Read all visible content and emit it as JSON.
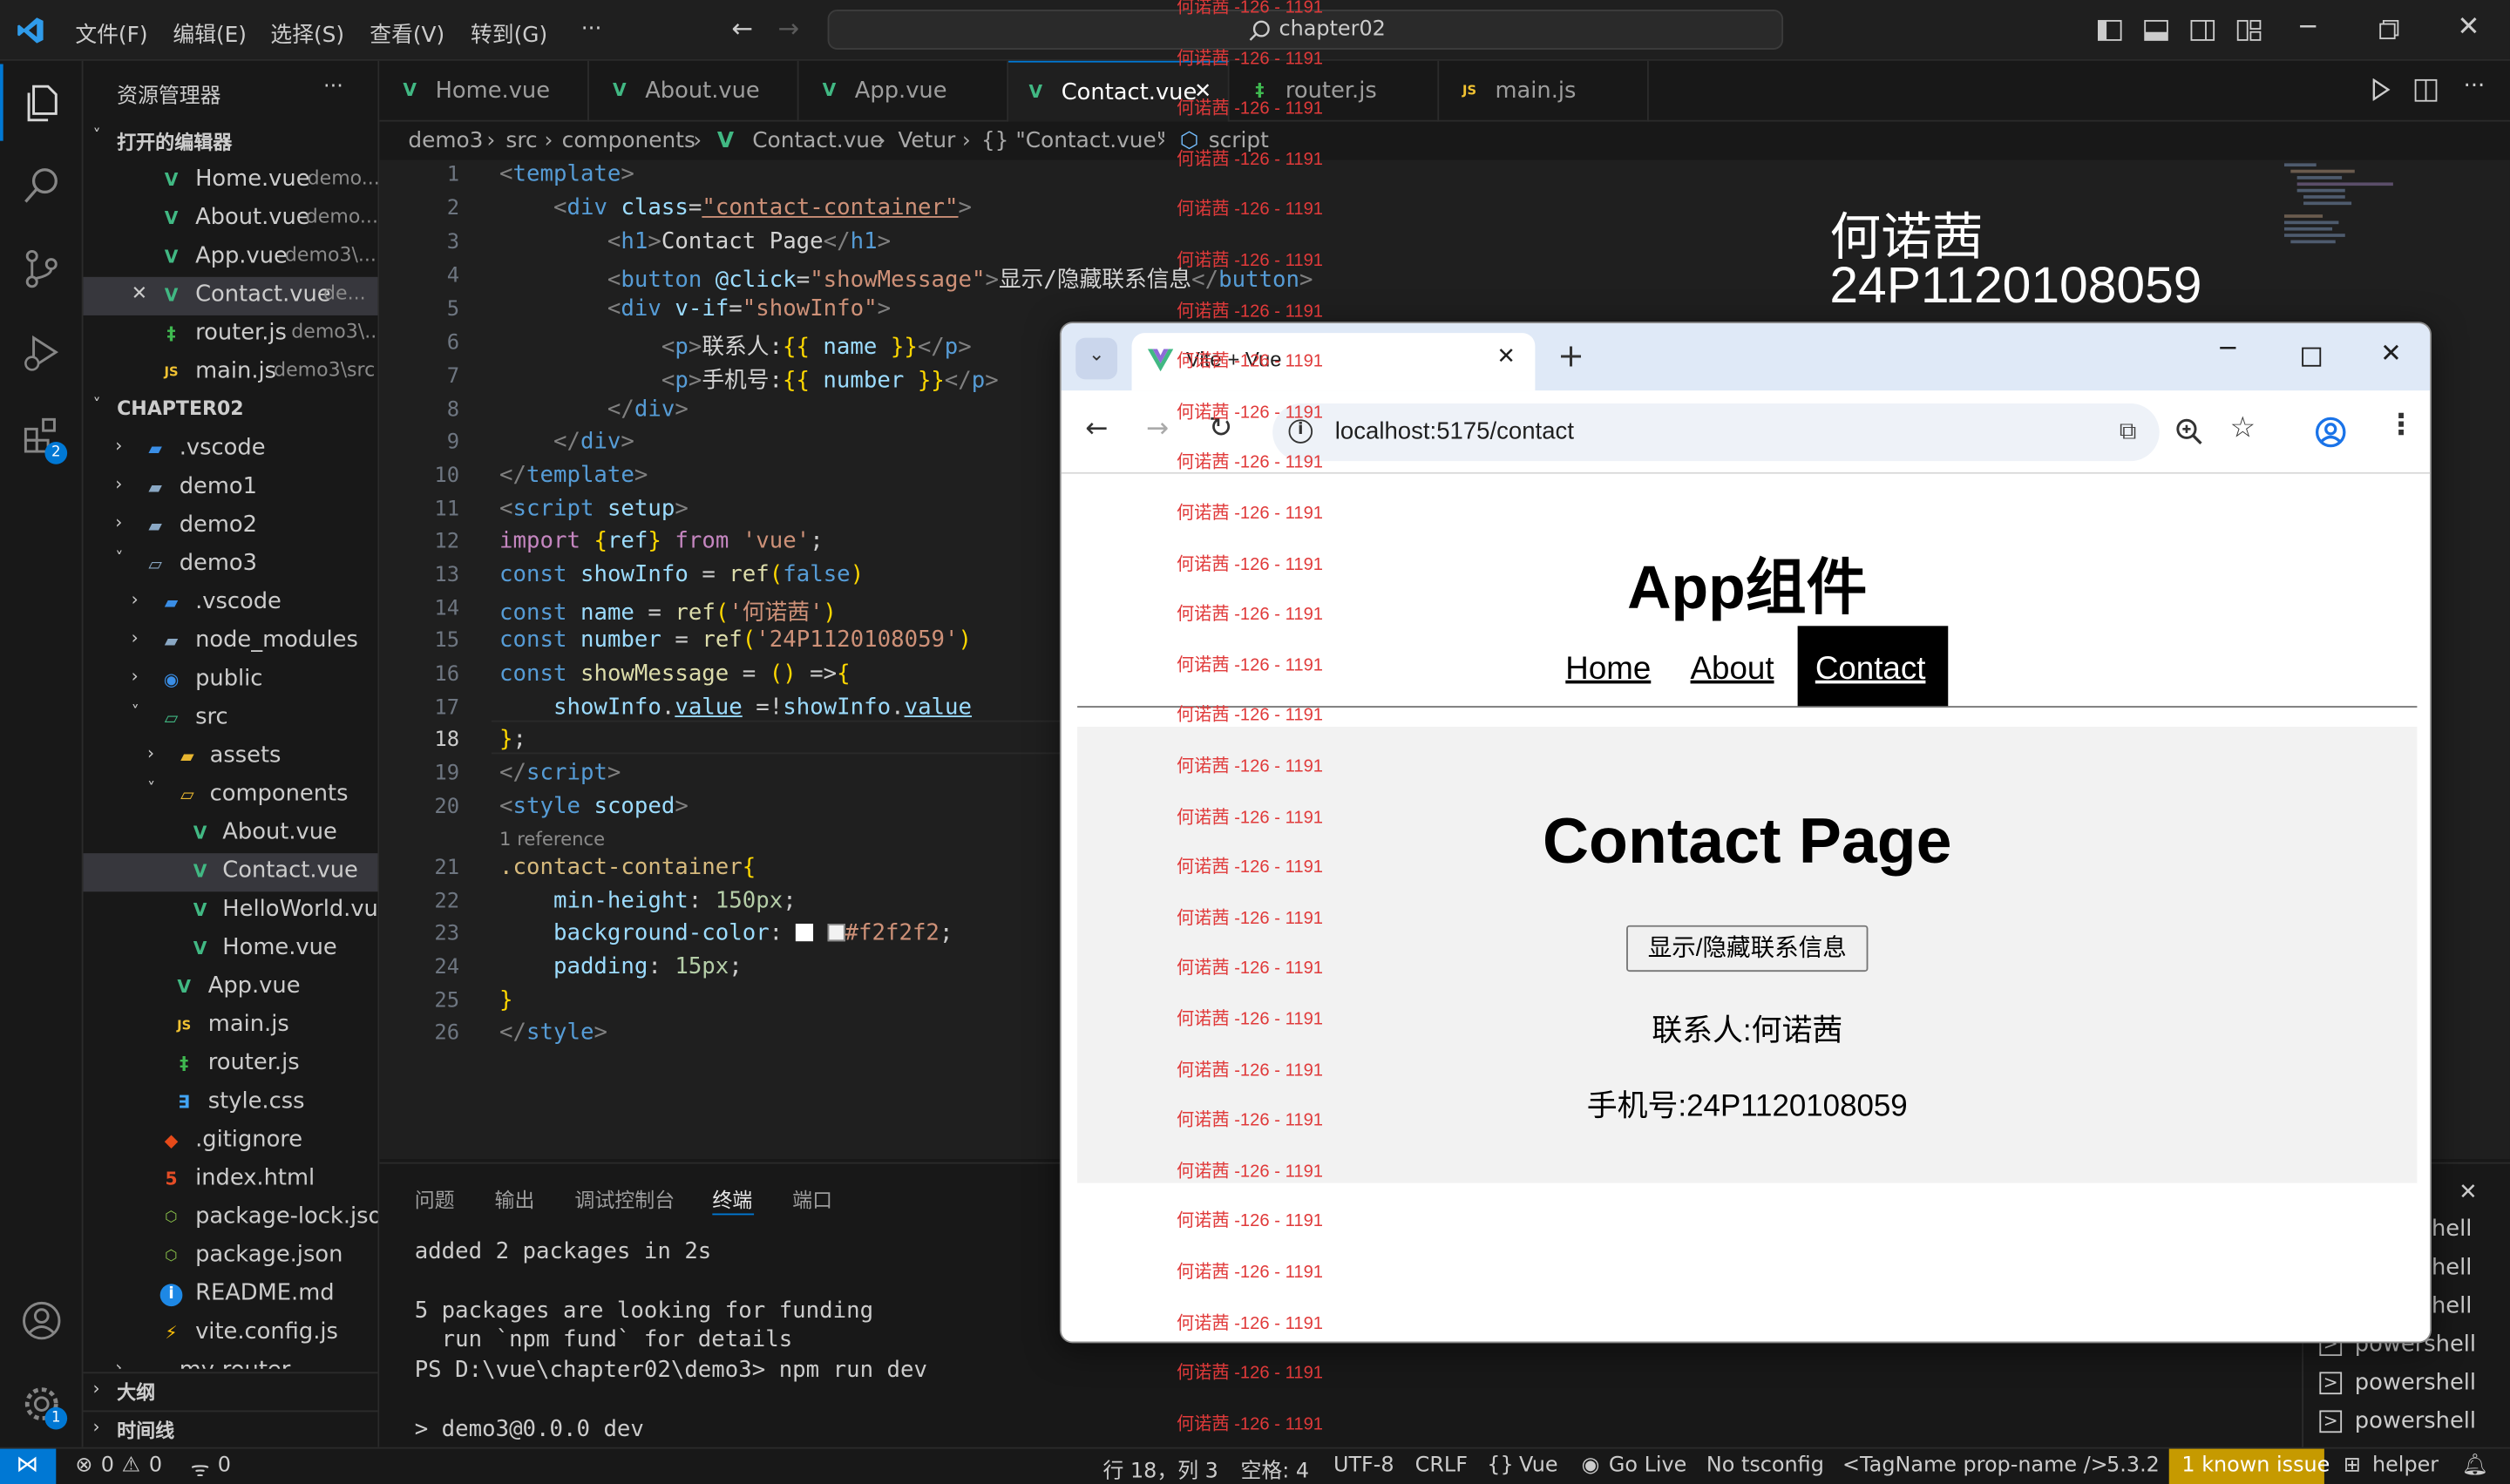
{
  "titlebar": {
    "menus": [
      "文件(F)",
      "编辑(E)",
      "选择(S)",
      "查看(V)",
      "转到(G)",
      "···"
    ],
    "search": "chapter02"
  },
  "activity": {
    "extensions_badge": "2",
    "settings_badge": "1"
  },
  "sidebar": {
    "title": "资源管理器",
    "more": "···",
    "open_editors_title": "打开的编辑器",
    "open_editors": [
      {
        "name": "Home.vue",
        "path": "demo..."
      },
      {
        "name": "About.vue",
        "path": "demo..."
      },
      {
        "name": "App.vue",
        "path": "demo3\\..."
      },
      {
        "name": "Contact.vue",
        "path": "de..."
      },
      {
        "name": "router.js",
        "path": "demo3\\..."
      },
      {
        "name": "main.js",
        "path": "demo3\\src"
      }
    ],
    "project_title": "CHAPTER02",
    "tree": [
      ".vscode",
      "demo1",
      "demo2",
      "demo3",
      ".vscode",
      "node_modules",
      "public",
      "src",
      "assets",
      "components",
      "About.vue",
      "Contact.vue",
      "HelloWorld.vue",
      "Home.vue",
      "App.vue",
      "main.js",
      "router.js",
      "style.css",
      ".gitignore",
      "index.html",
      "package-lock.json",
      "package.json",
      "README.md",
      "vite.config.js",
      "my-router"
    ],
    "outline": "大纲",
    "timeline": "时间线"
  },
  "tabs": [
    "Home.vue",
    "About.vue",
    "App.vue",
    "Contact.vue",
    "router.js",
    "main.js"
  ],
  "breadcrumb": [
    "demo3",
    "src",
    "components",
    "Contact.vue",
    "Vetur",
    "{} \"Contact.vue\"",
    "script"
  ],
  "editor": {
    "line_numbers": [
      "1",
      "2",
      "3",
      "4",
      "5",
      "6",
      "7",
      "8",
      "9",
      "10",
      "11",
      "12",
      "13",
      "14",
      "15",
      "16",
      "17",
      "18",
      "19",
      "20",
      "21",
      "22",
      "23",
      "24",
      "25",
      "26"
    ],
    "reference_hint": "1 reference"
  },
  "panel": {
    "tabs": [
      "问题",
      "输出",
      "调试控制台",
      "终端",
      "端口"
    ],
    "terminal_lines": [
      "added 2 packages in 2s",
      "5 packages are looking for funding",
      "  run `npm fund` for details",
      "PS D:\\vue\\chapter02\\demo3> npm run dev",
      "> demo3@0.0.0 dev"
    ],
    "shell_list": [
      "hell",
      "hell",
      "hell",
      "powershell",
      "powershell",
      "powershell"
    ]
  },
  "status": {
    "errors": "0",
    "warnings": "0",
    "ports": "0",
    "position": "行 18，列 3",
    "spaces": "空格: 4",
    "encoding": "UTF-8",
    "eol": "CRLF",
    "language": "Vue",
    "golive": "Go Live",
    "tsconfig": "No tsconfig",
    "tagname": "<TagName prop-name />",
    "version": "5.3.2",
    "issue": "1 known issue",
    "helper": "helper"
  },
  "overlay": {
    "name": "何诺茜",
    "number": "24P1120108059",
    "watermark": "何诺茜 -126 - 1191"
  },
  "browser": {
    "tab_title": "Vite + Vue",
    "url": "localhost:5175/contact",
    "app_title": "App组件",
    "nav": [
      "Home",
      "About",
      "Contact"
    ],
    "page_title": "Contact Page",
    "button": "显示/隐藏联系信息",
    "contact_line": "联系人:何诺茜",
    "phone_line": "手机号:24P1120108059"
  },
  "colors": {
    "accent": "#0078d4",
    "vue": "#41b883",
    "js": "#f1c232",
    "issue_bg": "#c69a00"
  }
}
